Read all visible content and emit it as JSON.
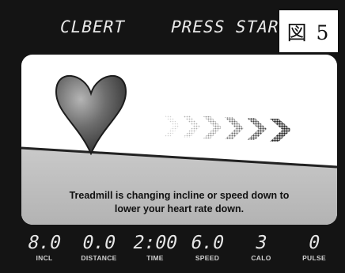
{
  "header": {
    "left_text": "CLBERT",
    "right_text": "PRESS START",
    "figure_label": "図 5"
  },
  "panel": {
    "message_line1": "Treadmill is changing incline or speed down to",
    "message_line2": "lower your heart rate down."
  },
  "readouts": [
    {
      "value": "8.0",
      "label": "INCL"
    },
    {
      "value": "0.0",
      "label": "DISTANCE"
    },
    {
      "value": "2:00",
      "label": "TIME"
    },
    {
      "value": "6.0",
      "label": "SPEED"
    },
    {
      "value": "3",
      "label": "CALO"
    },
    {
      "value": "0",
      "label": "PULSE"
    }
  ],
  "icons": {
    "heart": "heart-icon",
    "arrows": "chevron-right-icon"
  },
  "colors": {
    "screen_bg": "#141414",
    "panel_bg": "#ffffff",
    "panel_lower": "#bdbdbd"
  }
}
